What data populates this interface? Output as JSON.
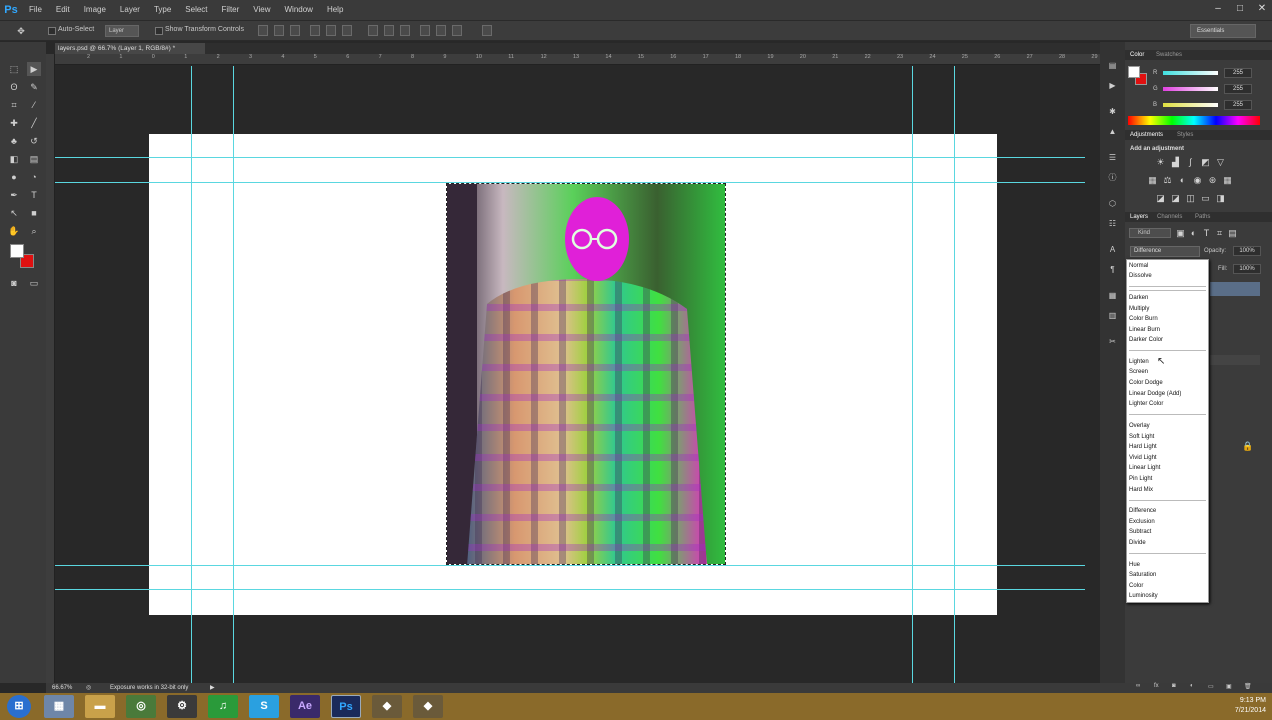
{
  "app": {
    "logo": "Ps"
  },
  "menu": [
    "File",
    "Edit",
    "Image",
    "Layer",
    "Type",
    "Select",
    "Filter",
    "View",
    "Window",
    "Help"
  ],
  "window_controls": [
    "–",
    "□",
    "✕"
  ],
  "options": {
    "auto_select_label": "Auto-Select",
    "auto_select_value": "Layer",
    "show_transform_label": "Show Transform Controls",
    "workspace": "Essentials"
  },
  "document": {
    "tab_title": "layers.psd @ 66.7% (Layer 1, RGB/8#) *"
  },
  "ruler_top_labels": [
    "2",
    "1",
    "0",
    "1",
    "2",
    "3",
    "4",
    "5",
    "6",
    "7",
    "8",
    "9",
    "10",
    "11",
    "12",
    "13",
    "14",
    "15",
    "16",
    "17",
    "18",
    "19",
    "20",
    "21",
    "22",
    "23",
    "24",
    "25",
    "26",
    "27",
    "28",
    "29"
  ],
  "panels": {
    "color_tab": "Color",
    "swatches_tab": "Swatches",
    "color_channels": [
      {
        "name": "R",
        "value": "255"
      },
      {
        "name": "G",
        "value": "255"
      },
      {
        "name": "B",
        "value": "255"
      }
    ],
    "adjustments_tab": "Adjustments",
    "styles_tab": "Styles",
    "add_adjustment": "Add an adjustment",
    "layers_tab": "Layers",
    "channels_tab": "Channels",
    "paths_tab": "Paths",
    "kind_label": "Kind",
    "blend_mode": "Difference",
    "opacity_label": "Opacity:",
    "opacity_value": "100%",
    "fill_label": "Fill:",
    "fill_value": "100%"
  },
  "blend_modes": [
    [
      "Normal",
      "Dissolve"
    ],
    [
      "Darken",
      "Multiply",
      "Color Burn",
      "Linear Burn",
      "Darker Color"
    ],
    [
      "Lighten",
      "Screen",
      "Color Dodge",
      "Linear Dodge (Add)",
      "Lighter Color"
    ],
    [
      "Overlay",
      "Soft Light",
      "Hard Light",
      "Vivid Light",
      "Linear Light",
      "Pin Light",
      "Hard Mix"
    ],
    [
      "Difference",
      "Exclusion",
      "Subtract",
      "Divide"
    ],
    [
      "Hue",
      "Saturation",
      "Color",
      "Luminosity"
    ]
  ],
  "status": {
    "zoom": "66.67%",
    "message": "Exposure works in 32-bit only"
  },
  "taskbar": {
    "apps": [
      "start",
      "file-explorer",
      "folder",
      "chrome",
      "steam",
      "spotify",
      "skype",
      "after-effects",
      "photoshop",
      "app-one",
      "app-two"
    ],
    "after_effects_label": "Ae",
    "photoshop_label": "Ps",
    "skype_label": "S",
    "time": "9:13 PM",
    "date": "7/21/2014"
  },
  "colors": {
    "accent": "#31a8ff",
    "guide": "#5ad7e0",
    "background_swatch": "#e01010"
  }
}
